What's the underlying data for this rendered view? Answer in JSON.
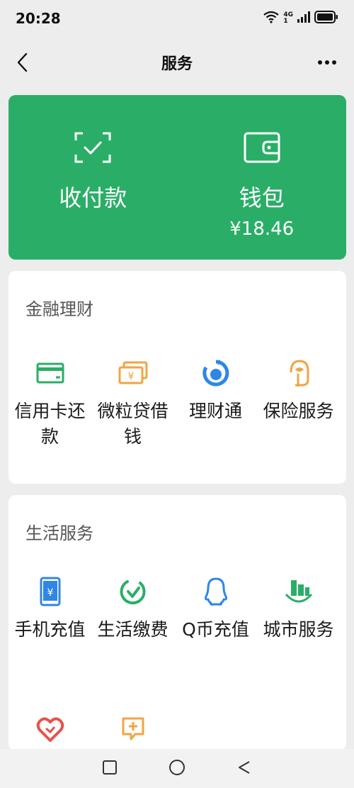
{
  "status_bar": {
    "time": "20:28",
    "network": "4G",
    "network_sub": "1"
  },
  "nav": {
    "title": "服务"
  },
  "pay_card": {
    "color": "#2aae67",
    "items": [
      {
        "label": "收付款",
        "icon": "scan-pay-icon"
      },
      {
        "label": "钱包",
        "sub": "¥18.46",
        "icon": "wallet-icon"
      }
    ]
  },
  "finance": {
    "title": "金融理财",
    "items": [
      {
        "label": "信用卡还款",
        "icon": "credit-card-icon",
        "color": "#2aae67"
      },
      {
        "label": "微粒贷借钱",
        "icon": "loan-icon",
        "color": "#f2a444"
      },
      {
        "label": "理财通",
        "icon": "wealth-icon",
        "color": "#2f86e6"
      },
      {
        "label": "保险服务",
        "icon": "insurance-icon",
        "color": "#f2a444"
      }
    ]
  },
  "life": {
    "title": "生活服务",
    "items": [
      {
        "label": "手机充值",
        "icon": "phone-topup-icon",
        "color": "#2f86e6"
      },
      {
        "label": "生活缴费",
        "icon": "utility-bill-icon",
        "color": "#2aae67"
      },
      {
        "label": "Q币充值",
        "icon": "qq-coin-icon",
        "color": "#2f86e6"
      },
      {
        "label": "城市服务",
        "icon": "city-service-icon",
        "color": "#2aae67"
      }
    ],
    "partial_icons": [
      {
        "icon": "charity-icon",
        "color": "#e5534b"
      },
      {
        "icon": "medical-icon",
        "color": "#f2a444"
      }
    ]
  }
}
